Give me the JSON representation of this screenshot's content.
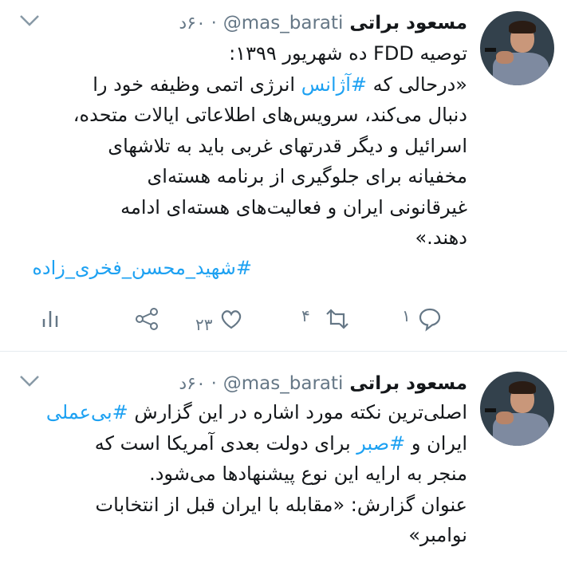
{
  "tweets": [
    {
      "author_name": "مسعود براتی",
      "handle": "@mas_barati",
      "time": "۶۰د",
      "text": "توصیه FDD ده شهریور ۱۳۹۹:\n«درحالی که #آژانس انرژی اتمی وظیفه خود را\nدنبال می‌کند، سرویس‌های اطلاعاتی ایالات متحده،\nاسرائیل و دیگر قدرتهای غربی باید به تلاشهای\nمخفیانه برای جلوگیری از برنامه هسته‌ای\nغیرقانونی ایران و فعالیت‌های هسته‌ای ادامه\nدهند.»",
      "hashtag": "#شهید_محسن_فخری_زاده",
      "actions": {
        "replies": "۱",
        "retweets": "۴",
        "likes": "۲۳"
      }
    },
    {
      "author_name": "مسعود براتی",
      "handle": "@mas_barati",
      "time": "۶۰د",
      "text": "اصلی‌ترین نکته مورد اشاره در این گزارش #بی‌عملی\nایران و #صبر برای دولت بعدی آمریکا است که\nمنجر به ارایه این نوع پیشنهادها می‌شود.\nعنوان گزارش: «مقابله با ایران قبل از انتخابات\nنوامبر»"
    }
  ],
  "colors": {
    "link": "#1da1f2",
    "secondary_text": "#657786",
    "divider": "#e6ecf0"
  },
  "icons": [
    "chevron-down-icon",
    "reply-icon",
    "retweet-icon",
    "like-icon",
    "share-icon",
    "analytics-icon"
  ]
}
